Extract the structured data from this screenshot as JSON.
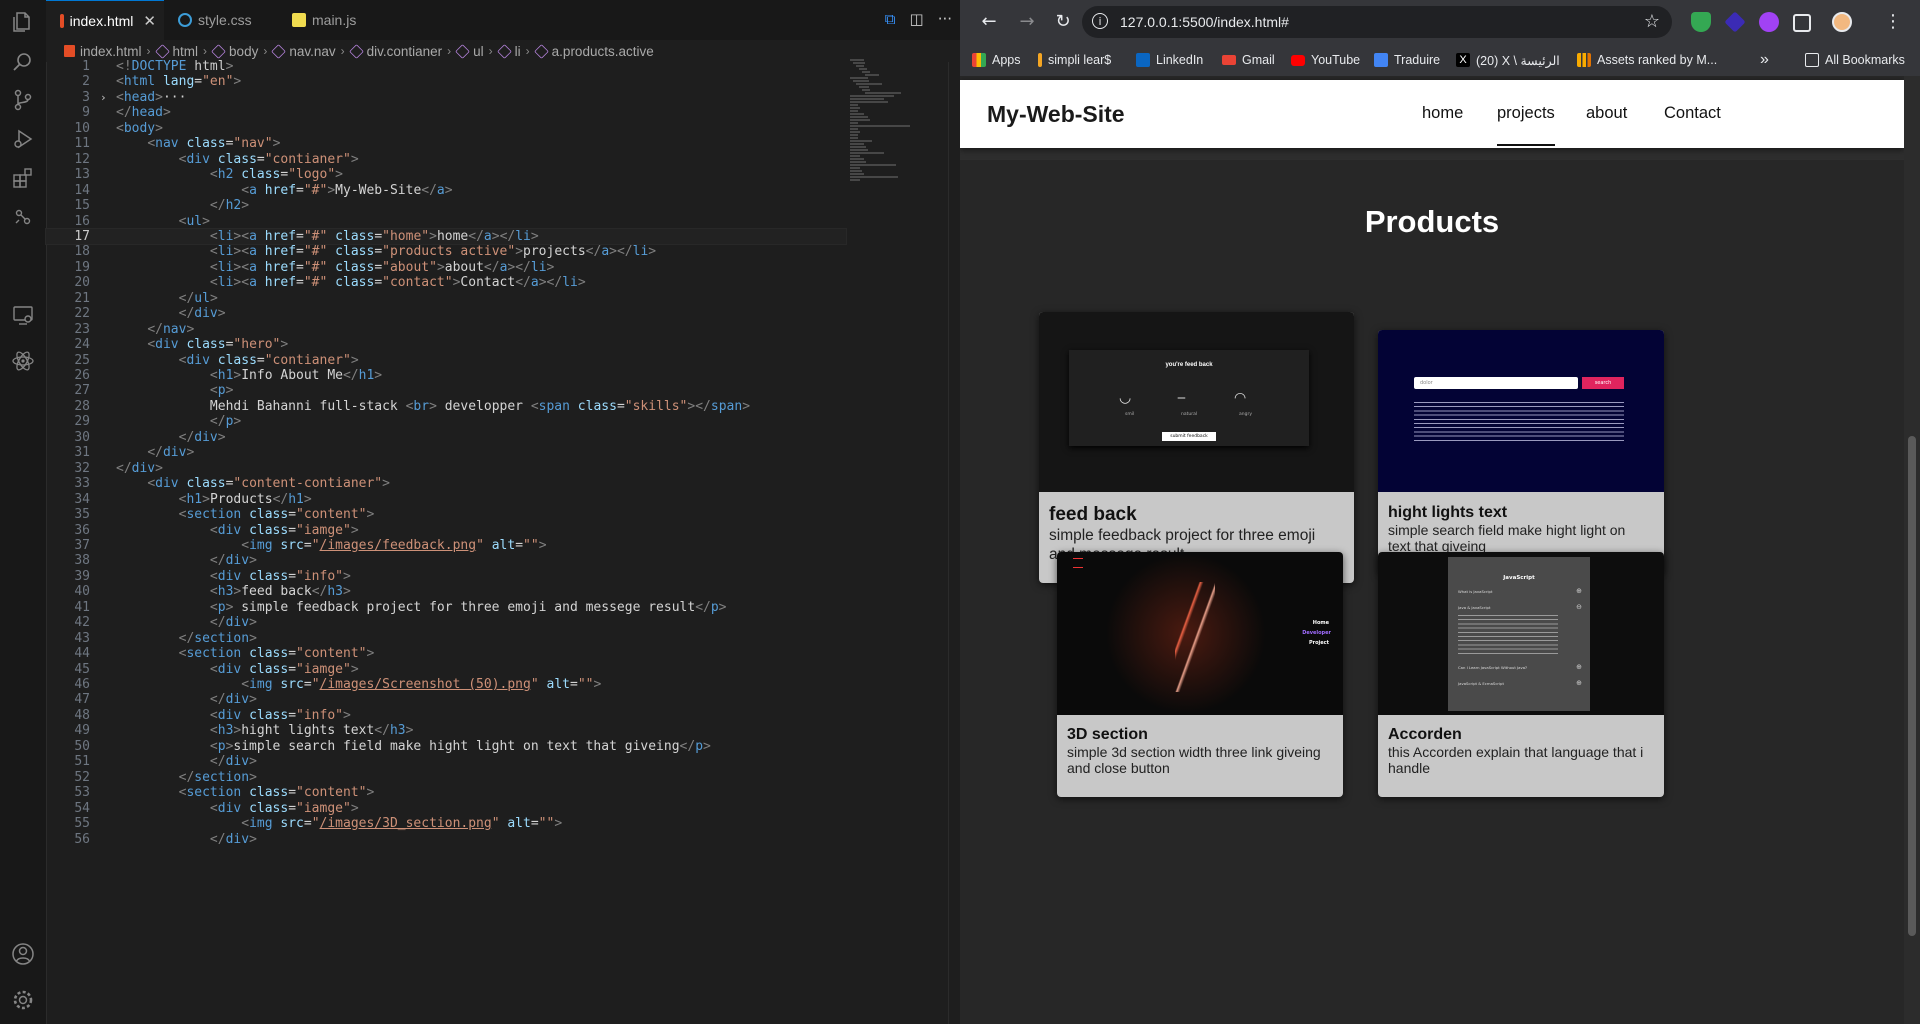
{
  "editor": {
    "tabs": [
      {
        "label": "index.html",
        "active": true,
        "icon": "html5-icon",
        "color": "#e44d26"
      },
      {
        "label": "style.css",
        "active": false,
        "icon": "css-icon",
        "color": "#3c9cd7"
      },
      {
        "label": "main.js",
        "active": false,
        "icon": "js-icon",
        "color": "#f0db4f"
      }
    ],
    "breadcrumbs": [
      "index.html",
      "html",
      "body",
      "nav.nav",
      "div.contianer",
      "ul",
      "li",
      "a.products.active"
    ],
    "current_line": 17,
    "lines": [
      {
        "n": "1",
        "text": "<!DOCTYPE html>"
      },
      {
        "n": "2",
        "text": "<html lang=\"en\">"
      },
      {
        "n": "3",
        "text": "<head>···"
      },
      {
        "n": "9",
        "text": "</head>"
      },
      {
        "n": "10",
        "text": "<body>"
      },
      {
        "n": "11",
        "text": "    <nav class=\"nav\">"
      },
      {
        "n": "12",
        "text": "        <div class=\"contianer\">"
      },
      {
        "n": "13",
        "text": "            <h2 class=\"logo\">"
      },
      {
        "n": "14",
        "text": "                <a href=\"#\">My-Web-Site</a>"
      },
      {
        "n": "15",
        "text": "            </h2>"
      },
      {
        "n": "16",
        "text": "        <ul>"
      },
      {
        "n": "17",
        "text": "            <li><a href=\"#\" class=\"home\">home</a></li>"
      },
      {
        "n": "18",
        "text": "            <li><a href=\"#\" class=\"products active\">projects</a></li>"
      },
      {
        "n": "19",
        "text": "            <li><a href=\"#\" class=\"about\">about</a></li>"
      },
      {
        "n": "20",
        "text": "            <li><a href=\"#\" class=\"contact\">Contact</a></li>"
      },
      {
        "n": "21",
        "text": "        </ul>"
      },
      {
        "n": "22",
        "text": "        </div>"
      },
      {
        "n": "23",
        "text": "    </nav>"
      },
      {
        "n": "24",
        "text": "    <div class=\"hero\">"
      },
      {
        "n": "25",
        "text": "        <div class=\"contianer\">"
      },
      {
        "n": "26",
        "text": "            <h1>Info About Me</h1>"
      },
      {
        "n": "27",
        "text": "            <p>"
      },
      {
        "n": "28",
        "text": "            Mehdi Bahanni full-stack <br> developper <span class=\"skills\"></span>"
      },
      {
        "n": "29",
        "text": "            </p>"
      },
      {
        "n": "30",
        "text": "        </div>"
      },
      {
        "n": "31",
        "text": "    </div>"
      },
      {
        "n": "32",
        "text": "</div>"
      },
      {
        "n": "33",
        "text": "    <div class=\"content-contianer\">"
      },
      {
        "n": "34",
        "text": "        <h1>Products</h1>"
      },
      {
        "n": "35",
        "text": "        <section class=\"content\">"
      },
      {
        "n": "36",
        "text": "            <div class=\"iamge\">"
      },
      {
        "n": "37",
        "text": "                <img src=\"/images/feedback.png\" alt=\"\">"
      },
      {
        "n": "38",
        "text": "            </div>"
      },
      {
        "n": "39",
        "text": "            <div class=\"info\">"
      },
      {
        "n": "40",
        "text": "            <h3>feed back</h3>"
      },
      {
        "n": "41",
        "text": "            <p> simple feedback project for three emoji and messege result</p>"
      },
      {
        "n": "42",
        "text": "            </div>"
      },
      {
        "n": "43",
        "text": "        </section>"
      },
      {
        "n": "44",
        "text": "        <section class=\"content\">"
      },
      {
        "n": "45",
        "text": "            <div class=\"iamge\">"
      },
      {
        "n": "46",
        "text": "                <img src=\"/images/Screenshot (50).png\" alt=\"\">"
      },
      {
        "n": "47",
        "text": "            </div>"
      },
      {
        "n": "48",
        "text": "            <div class=\"info\">"
      },
      {
        "n": "49",
        "text": "            <h3>hight lights text</h3>"
      },
      {
        "n": "50",
        "text": "            <p>simple search field make hight light on text that giveing</p>"
      },
      {
        "n": "51",
        "text": "            </div>"
      },
      {
        "n": "52",
        "text": "        </section>"
      },
      {
        "n": "53",
        "text": "        <section class=\"content\">"
      },
      {
        "n": "54",
        "text": "            <div class=\"iamge\">"
      },
      {
        "n": "55",
        "text": "                <img src=\"/images/3D_section.png\" alt=\"\">"
      },
      {
        "n": "56",
        "text": "            </div>"
      }
    ]
  },
  "browser": {
    "url": "127.0.0.1:5500/index.html#",
    "bookmarks": [
      {
        "label": "Apps",
        "icon": "apps-grid-icon",
        "color": "#8ab4f8"
      },
      {
        "label": "simpli lear$",
        "icon": "simplilearn-icon",
        "color": "#f5a623"
      },
      {
        "label": "LinkedIn",
        "icon": "linkedin-icon",
        "color": "#0a66c2"
      },
      {
        "label": "Gmail",
        "icon": "gmail-icon",
        "color": "#ea4335"
      },
      {
        "label": "YouTube",
        "icon": "youtube-icon",
        "color": "#ff0000"
      },
      {
        "label": "Traduire",
        "icon": "translate-icon",
        "color": "#4285f4"
      },
      {
        "label": "(20) X \\ الرئيسة",
        "icon": "x-icon",
        "color": "#000000"
      },
      {
        "label": "Assets ranked by M...",
        "icon": "chart-bars-icon",
        "color": "#f9ab00"
      }
    ],
    "more_bookmarks": "»",
    "all_bookmarks": "All Bookmarks"
  },
  "site": {
    "logo": "My-Web-Site",
    "nav": [
      "home",
      "projects",
      "about",
      "Contact"
    ],
    "active_nav": "projects",
    "section_title": "Products",
    "cards": [
      {
        "title": "feed back",
        "desc": "simple feedback project for three emoji and messege result",
        "preview": {
          "heading": "you're feed back",
          "faces": [
            "smil",
            "natural",
            "angry"
          ],
          "button": "submit feedback"
        }
      },
      {
        "title": "hight lights text",
        "desc": "simple search field make hight light on text that giveing",
        "preview": {
          "input": "dolor",
          "button": "search"
        }
      },
      {
        "title": "3D section",
        "desc": "simple 3d section width three link giveing and close button",
        "preview": {
          "links": [
            "Home",
            "Developer",
            "Project"
          ]
        }
      },
      {
        "title": "Accorden",
        "desc": "this Accorden explain that language that i handle",
        "preview": {
          "heading": "JavaScript",
          "items": [
            "What is JavaScript",
            "Java & JavaScript",
            "Can I Learn JavaScript Without Java?",
            "JavaScript & EcmaScript"
          ]
        }
      }
    ]
  }
}
